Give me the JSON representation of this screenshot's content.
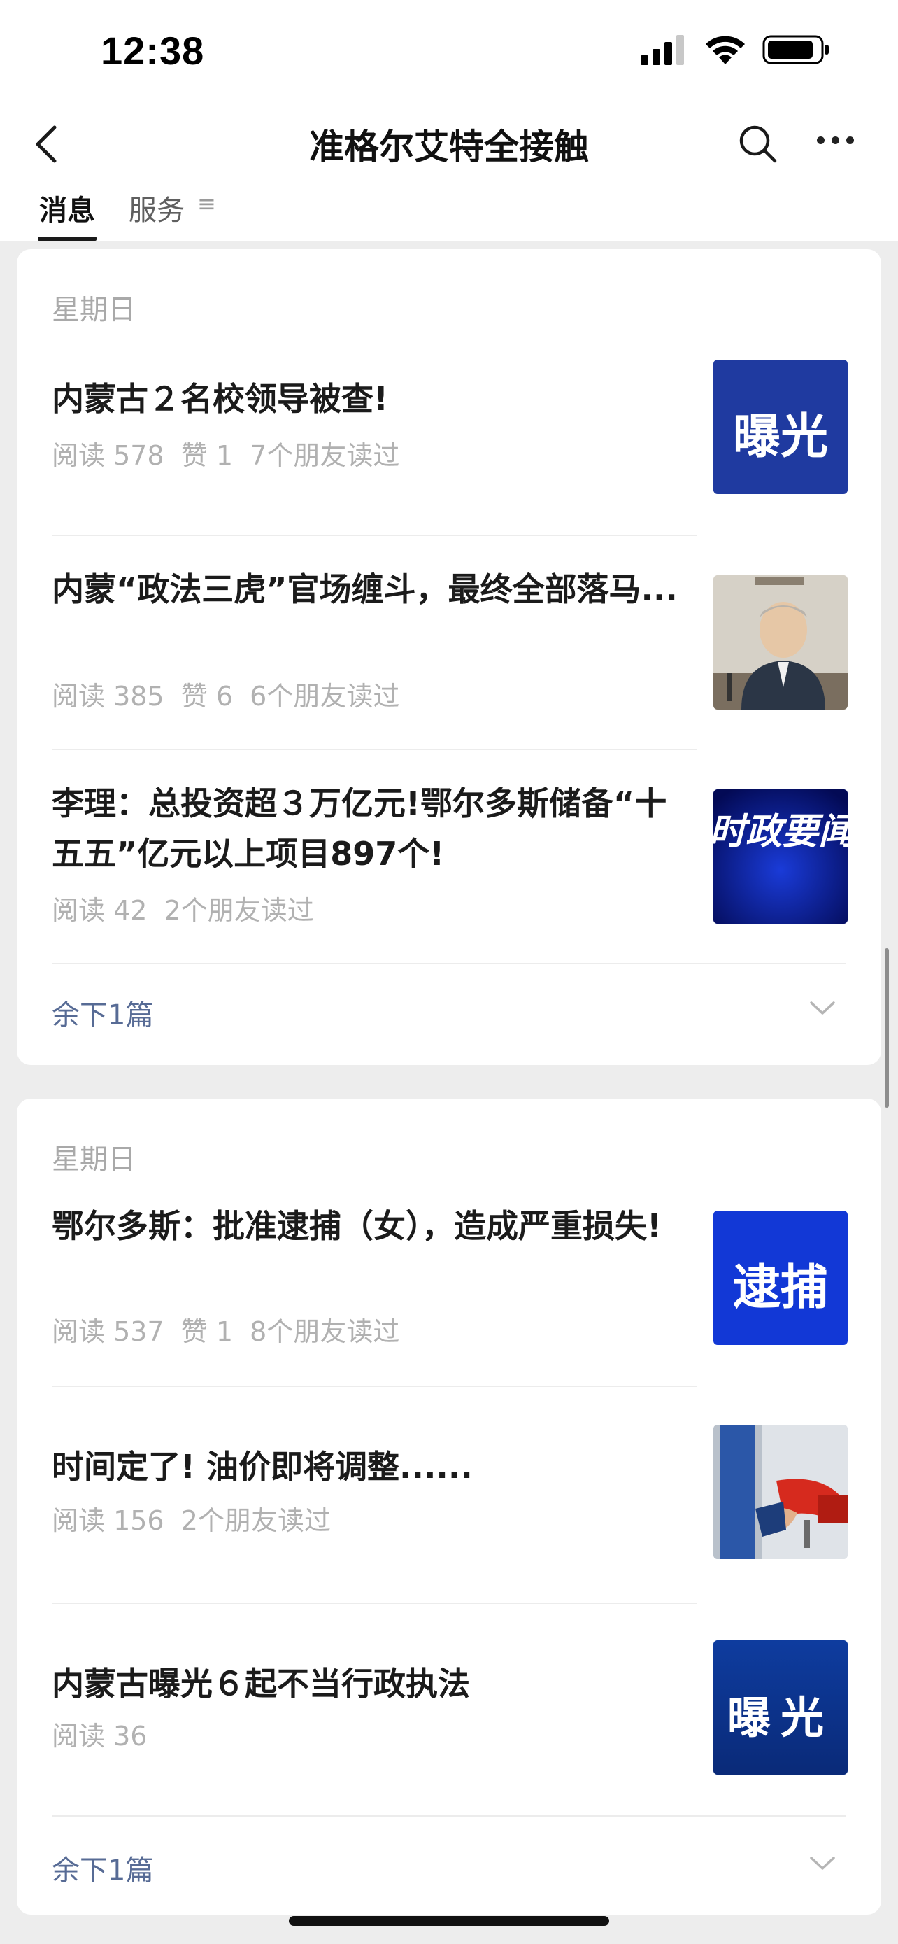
{
  "status_bar": {
    "time": "12:38"
  },
  "nav": {
    "title": "准格尔艾特全接触"
  },
  "tabs": [
    {
      "label": "消息"
    },
    {
      "label": "服务",
      "menu_glyph": "≡"
    }
  ],
  "cards": [
    {
      "date": "星期日",
      "articles": [
        {
          "title": "内蒙古２名校领导被查!",
          "meta": "阅读 578  赞 1  7个朋友读过",
          "thumb_text": "曝光",
          "thumb_bg": "#1f3aa0"
        },
        {
          "title": "内蒙“政法三虎”官场缠斗，最终全部落马...",
          "meta": "阅读 385  赞 6  6个朋友读过",
          "thumb_text": "",
          "thumb_bg": "#cfc9be"
        },
        {
          "title": "李理：总投资超３万亿元!鄂尔多斯储备“十五五”亿元以上项目897个!",
          "meta": "阅读 42  2个朋友读过",
          "thumb_text": "时政要闻",
          "thumb_bg": "#0a1f9e"
        }
      ],
      "more_label": "余下1篇"
    },
    {
      "date": "星期日",
      "articles": [
        {
          "title": "鄂尔多斯：批准逮捕（女），造成严重损失!",
          "meta": "阅读 537  赞 1  8个朋友读过",
          "thumb_text": "逮捕",
          "thumb_bg": "#1238d6"
        },
        {
          "title": "时间定了!  油价即将调整......",
          "meta": "阅读 156  2个朋友读过",
          "thumb_text": "",
          "thumb_bg": "#d8dde3"
        },
        {
          "title": "内蒙古曝光６起不当行政执法",
          "meta": "阅读 36",
          "thumb_text": "曝光",
          "thumb_bg": "#0f3a9a"
        }
      ],
      "more_label": "余下1篇"
    }
  ],
  "icons": {
    "signal": "signal-icon",
    "wifi": "wifi-icon",
    "battery": "battery-icon",
    "back": "back-chevron-icon",
    "search": "search-icon",
    "more": "more-dots-icon",
    "expand": "chevron-down-icon"
  }
}
